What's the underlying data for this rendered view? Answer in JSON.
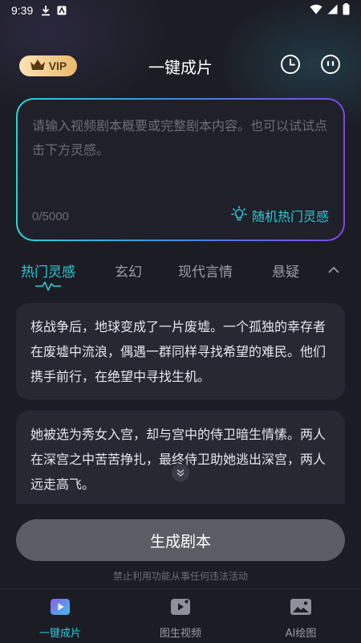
{
  "status_bar": {
    "time": "9:39"
  },
  "header": {
    "vip_label": "VIP",
    "title": "一键成片"
  },
  "prompt": {
    "placeholder": "请输入视频剧本概要或完整剧本内容。也可以试试点击下方灵感。",
    "value": "",
    "char_count": "0/5000",
    "random_label": "随机热门灵感"
  },
  "tabs": [
    {
      "label": "热门灵感",
      "active": true
    },
    {
      "label": "玄幻"
    },
    {
      "label": "现代言情"
    },
    {
      "label": "悬疑"
    }
  ],
  "inspirations": [
    "核战争后，地球变成了一片废墟。一个孤独的幸存者在废墟中流浪，偶遇一群同样寻找希望的难民。他们携手前行，在绝望中寻找生机。",
    "她被选为秀女入宫，却与宫中的侍卫暗生情愫。两人在深宫之中苦苦挣扎，最终侍卫助她逃出深宫，两人远走高飞。"
  ],
  "generate_label": "生成剧本",
  "disclaimer": "禁止利用功能从事任何违法活动",
  "bottom_nav": [
    {
      "label": "一键成片",
      "active": true,
      "icon": "video-play-icon"
    },
    {
      "label": "图生视频",
      "icon": "image-video-icon"
    },
    {
      "label": "AI绘图",
      "icon": "image-icon"
    }
  ],
  "colors": {
    "accent": "#2fc8d8",
    "background": "#1c1d24",
    "card": "#272832",
    "vip_gold": "#e9b96f"
  }
}
